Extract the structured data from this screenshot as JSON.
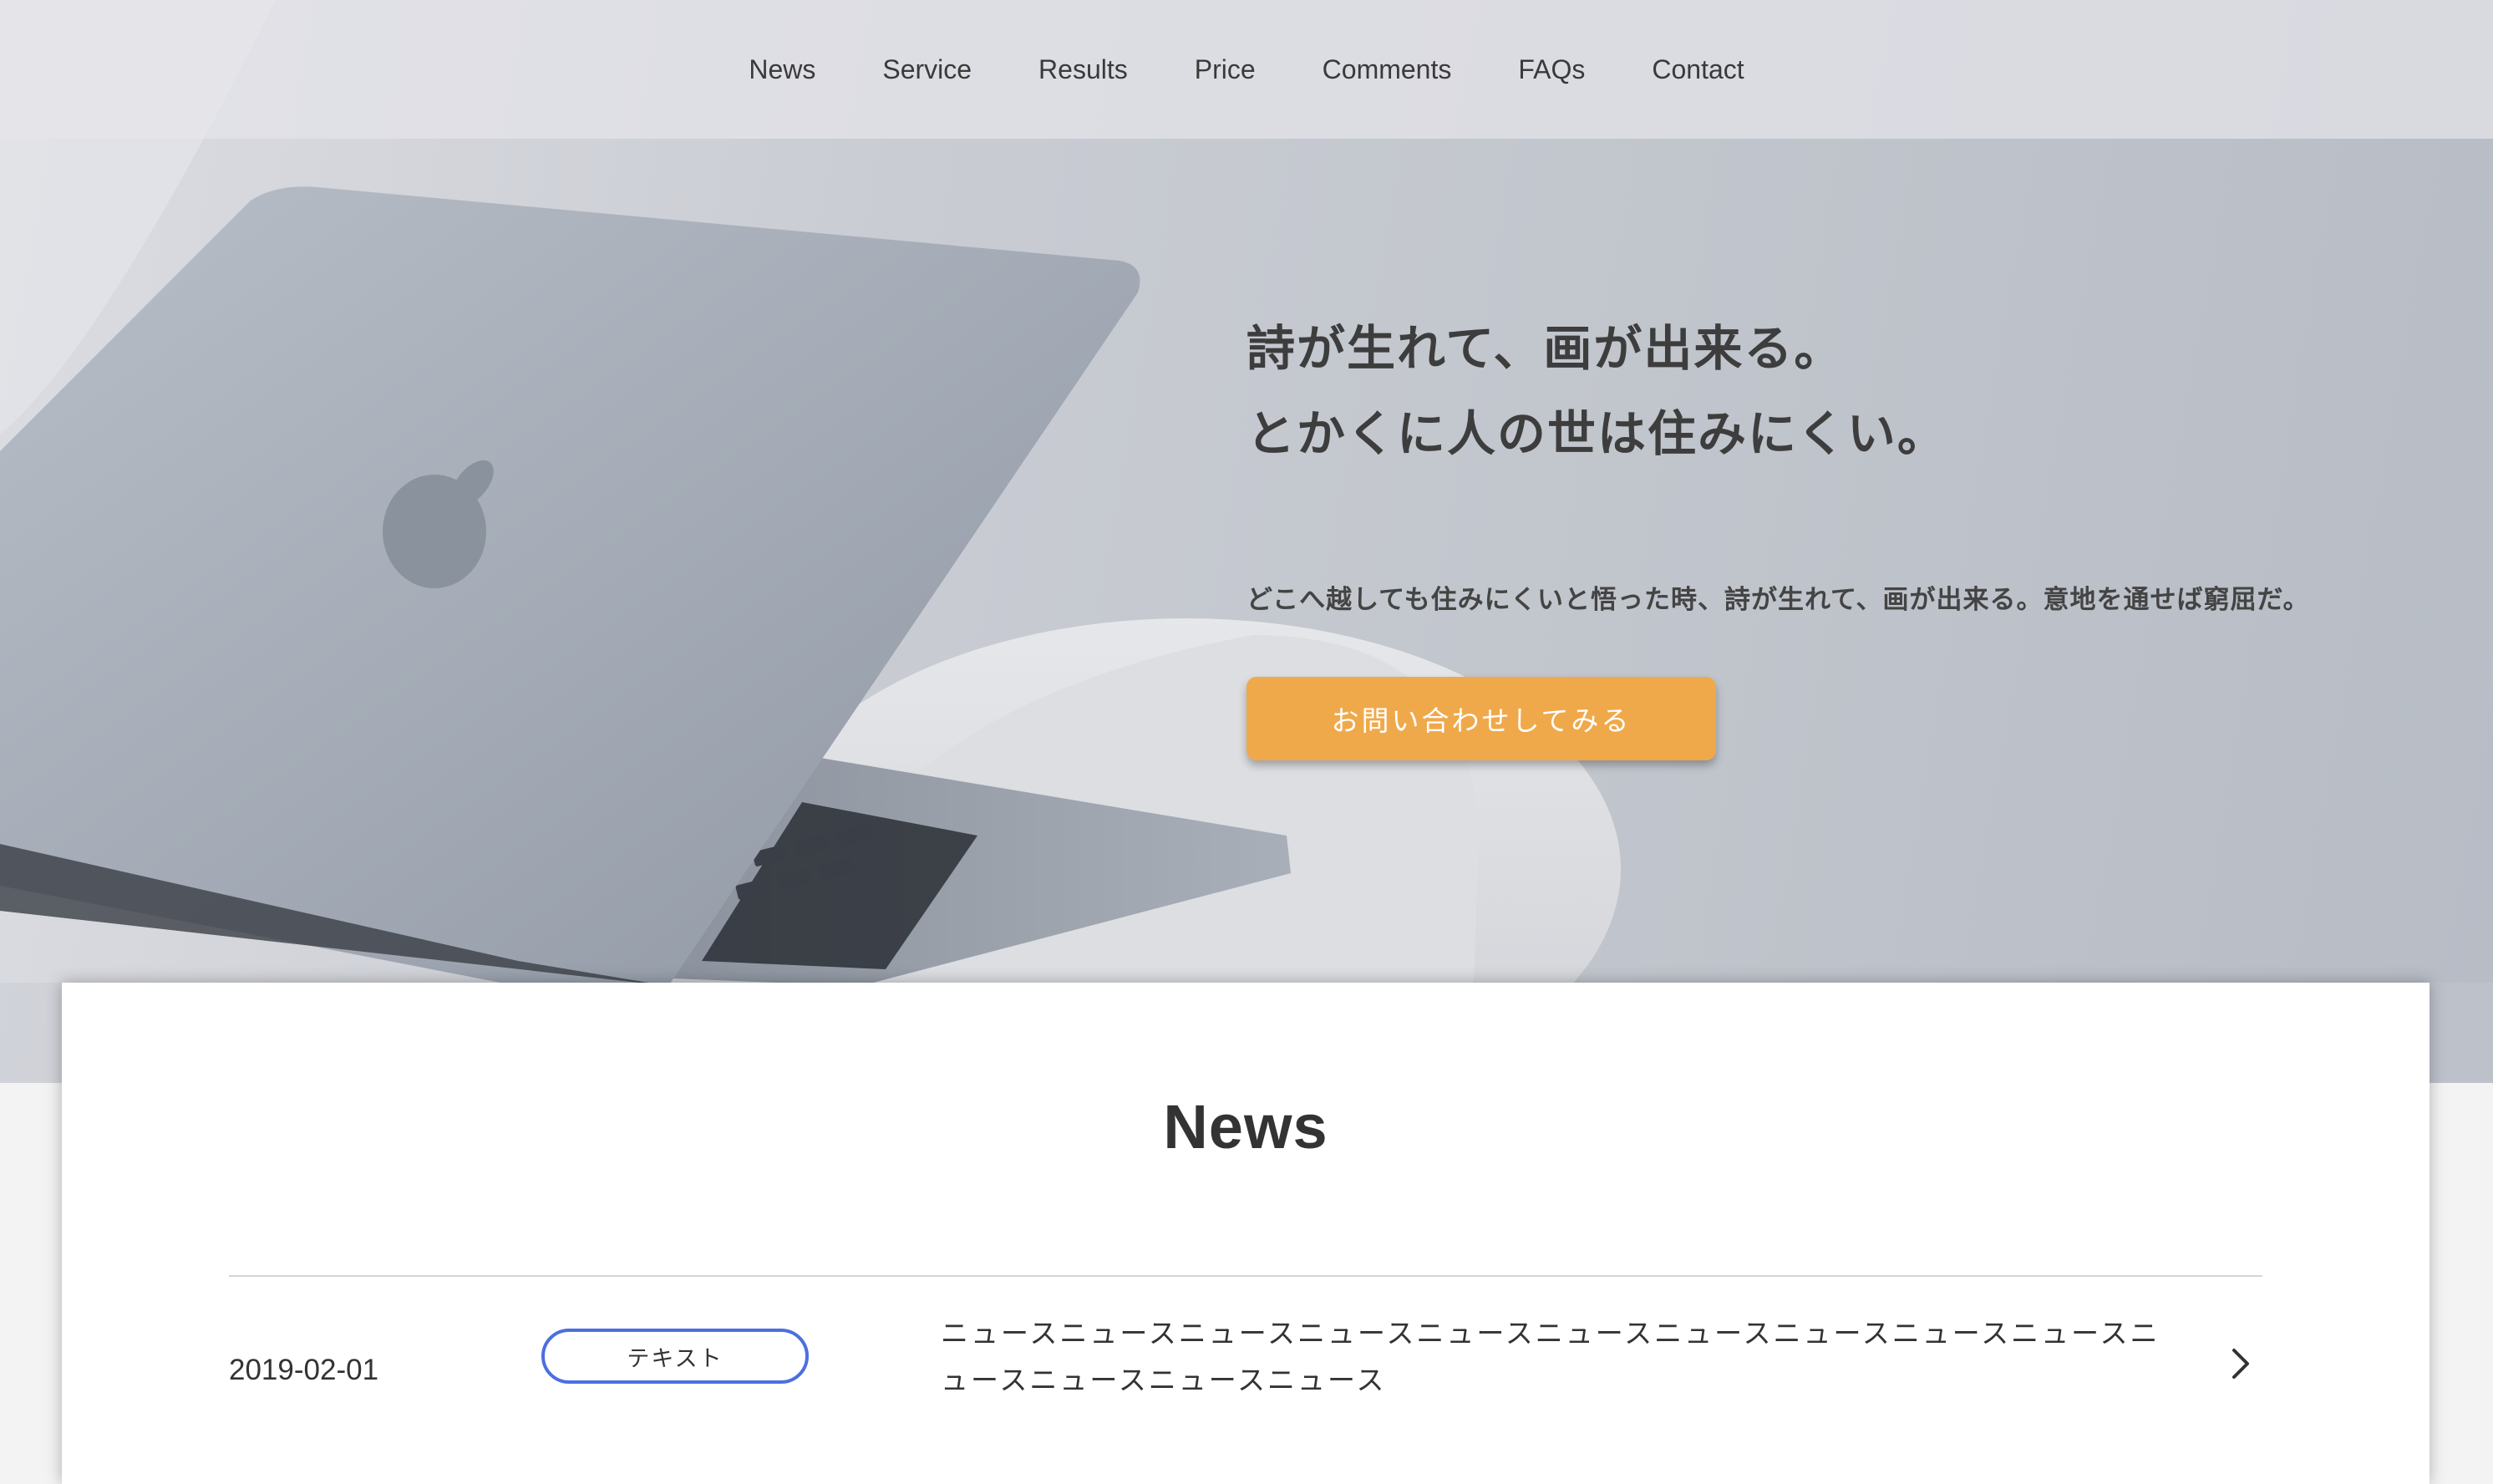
{
  "nav": {
    "items": [
      {
        "label": "News"
      },
      {
        "label": "Service"
      },
      {
        "label": "Results"
      },
      {
        "label": "Price"
      },
      {
        "label": "Comments"
      },
      {
        "label": "FAQs"
      },
      {
        "label": "Contact"
      }
    ]
  },
  "hero": {
    "title_line1": "詩が生れて、画が出来る。",
    "title_line2": "とかくに人の世は住みにくい。",
    "lead": "どこへ越しても住みにくいと悟った時、詩が生れて、画が出来る。意地を通せば窮屈だ。",
    "cta_label": "お問い合わせしてみる",
    "cta_color": "#f0a94a"
  },
  "news": {
    "heading": "News",
    "items": [
      {
        "date": "2019-02-01",
        "tag": "テキスト",
        "text": "ニュースニュースニュースニュースニュースニュースニュースニュースニュースニュースニュースニュースニュースニュース",
        "icon": "chevron-right-icon"
      }
    ],
    "tag_border_color": "#4b6fe0"
  }
}
